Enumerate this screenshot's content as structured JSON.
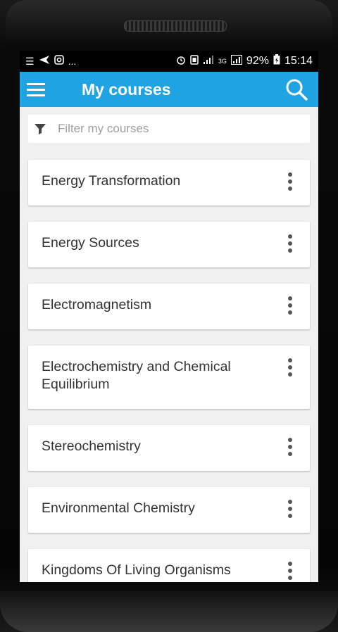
{
  "status_bar": {
    "left_icons": [
      "list-icon",
      "send-icon",
      "instagram-icon"
    ],
    "left_more": "...",
    "network": "3G",
    "battery": "92%",
    "time": "15:14"
  },
  "app_bar": {
    "title": "My courses",
    "menu_icon": "hamburger-menu-icon",
    "search_icon": "search-icon"
  },
  "filter": {
    "placeholder": "Filter my courses",
    "value": ""
  },
  "courses": [
    {
      "name": "Energy Transformation"
    },
    {
      "name": "Energy Sources"
    },
    {
      "name": "Electromagnetism"
    },
    {
      "name": "Electrochemistry and Chemical Equilibrium"
    },
    {
      "name": "Stereochemistry"
    },
    {
      "name": "Environmental Chemistry"
    },
    {
      "name": "Kingdoms Of Living Organisms"
    }
  ],
  "colors": {
    "app_bar": "#1fa3e2",
    "background": "#f0f0f0",
    "card": "#ffffff"
  }
}
